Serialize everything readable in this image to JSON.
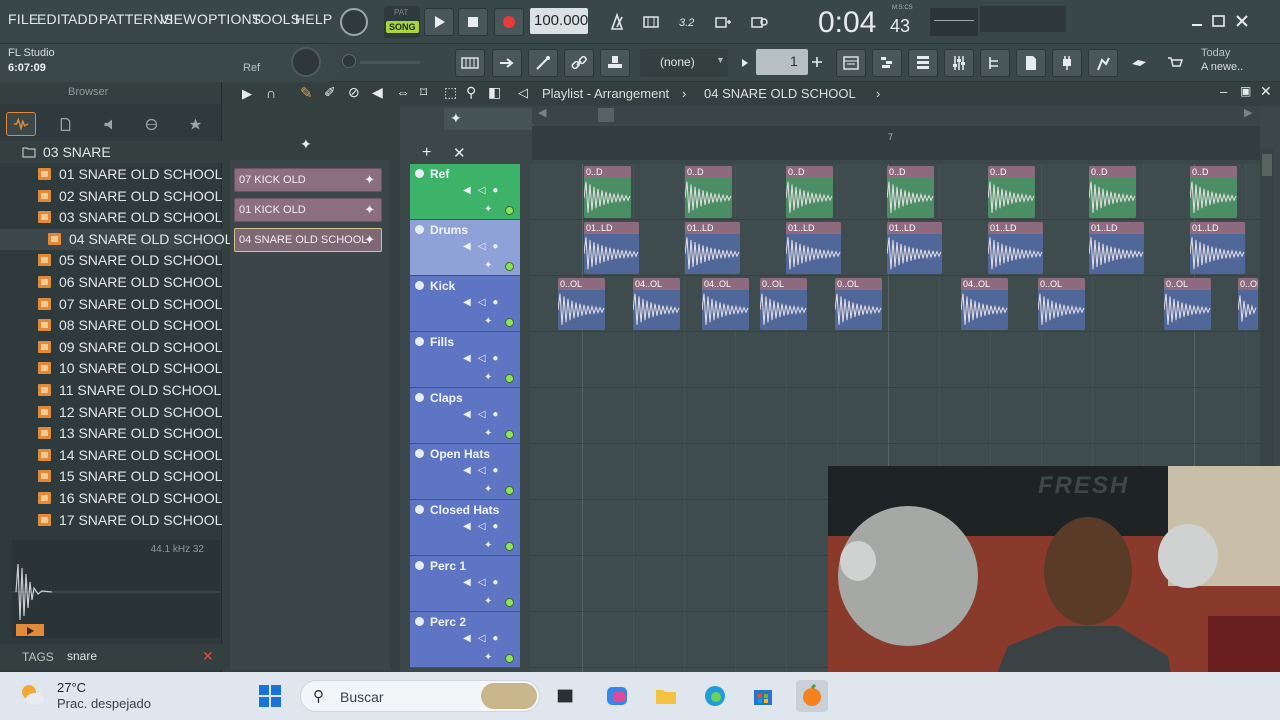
{
  "menu": [
    "FILE",
    "EDIT",
    "ADD",
    "PATTERNS",
    "VIEW",
    "OPTIONS",
    "TOOLS",
    "HELP"
  ],
  "transport": {
    "pat_label": "PAT",
    "song_label": "SONG",
    "tempo": "100.000",
    "time": "0:04",
    "time_frac": "43",
    "time_mode": "M:S:CS"
  },
  "hint": {
    "app": "FL Studio",
    "time": "6:07:09",
    "ref": "Ref"
  },
  "pattern_selector": "(none)",
  "step_value": "1",
  "news": {
    "line1": "Today",
    "line2": "A newe.."
  },
  "browser": {
    "title": "Browser",
    "current_folder": "03 SNARE",
    "items": [
      "01 SNARE OLD SCHOOL",
      "02 SNARE OLD SCHOOL",
      "03 SNARE OLD SCHOOL",
      "04 SNARE OLD SCHOOL",
      "05 SNARE OLD SCHOOL",
      "06 SNARE OLD SCHOOL",
      "07 SNARE OLD SCHOOL",
      "08 SNARE OLD SCHOOL",
      "09 SNARE OLD SCHOOL",
      "10 SNARE OLD SCHOOL",
      "11 SNARE OLD SCHOOL",
      "12 SNARE OLD SCHOOL",
      "13 SNARE OLD SCHOOL",
      "14 SNARE OLD SCHOOL",
      "15 SNARE OLD SCHOOL",
      "16 SNARE OLD SCHOOL",
      "17 SNARE OLD SCHOOL"
    ],
    "sample_info": "44.1 kHz 32",
    "tags_label": "TAGS",
    "tag_search": "snare"
  },
  "patterns": [
    "07 KICK OLD",
    "01 KICK OLD",
    "04 SNARE OLD SCHOOL"
  ],
  "playlist": {
    "title": "Playlist - Arrangement",
    "clip": "04 SNARE OLD SCHOOL",
    "bar_marker": "7"
  },
  "tracks": [
    "Ref",
    "Drums",
    "Kick",
    "Fills",
    "Claps",
    "Open Hats",
    "Closed Hats",
    "Perc 1",
    "Perc 2"
  ],
  "clips": {
    "ref": "0..D",
    "drums": "01..LD",
    "kick": [
      "0..OL",
      "04..OL",
      "04..OL",
      "0..OL",
      "0..OL",
      "04..OL",
      "0..OL",
      "0..OL"
    ]
  },
  "taskbar": {
    "temp": "27°C",
    "weather": "Prac. despejado",
    "search": "Buscar"
  },
  "webcam_text": "FRESH"
}
